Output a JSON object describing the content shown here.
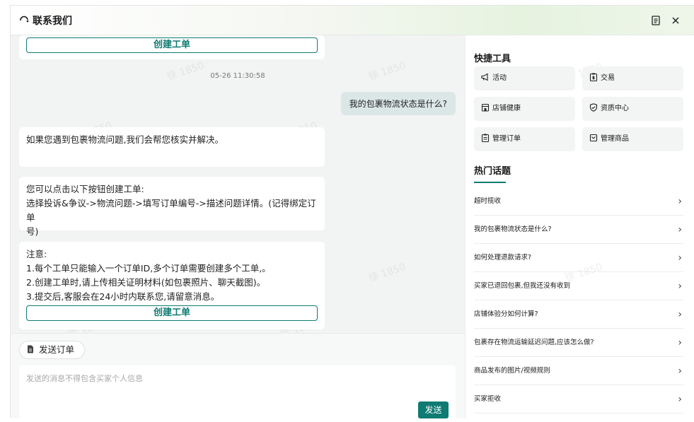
{
  "window": {
    "title": "联系我们"
  },
  "chat": {
    "create_ticket_label": "创建工单",
    "timestamp": "05-26 11:30:58",
    "user_message": "我的包裹物流状态是什么?",
    "bot_reply_1": "如果您遇到包裹物流问题,我们会帮您核实并解决。",
    "bot_reply_2_lines": [
      "您可以点击以下按钮创建工单:",
      "选择投诉&争议->物流问题->填写订单编号->描述问题详情。(记得绑定订单",
      "号)"
    ],
    "bot_reply_3_lines": [
      "注意:",
      "1.每个工单只能输入一个订单ID,多个订单需要创建多个工单,。",
      "2.创建工单时,请上传相关证明材料(如包裹照片、聊天截图)。",
      "3.提交后,客服会在24小时内联系您,请留意消息。"
    ],
    "watermark": "徐 1850"
  },
  "composer": {
    "send_order_label": "发送订单",
    "placeholder": "发送的消息不得包含买家个人信息",
    "send_label": "发送"
  },
  "sidebar": {
    "quick_tools_title": "快捷工具",
    "tools": [
      {
        "label": "活动",
        "icon": "megaphone-icon"
      },
      {
        "label": "交易",
        "icon": "clipboard-dollar-icon"
      },
      {
        "label": "店铺健康",
        "icon": "store-icon"
      },
      {
        "label": "资质中心",
        "icon": "shield-check-icon"
      },
      {
        "label": "管理订单",
        "icon": "clipboard-list-icon"
      },
      {
        "label": "管理商品",
        "icon": "box-icon"
      }
    ],
    "hot_topics_title": "热门话题",
    "topics": [
      "超时揽收",
      "我的包裹物流状态是什么?",
      "如何处理退款请求?",
      "买家已退回包裹,但我还没有收到",
      "店铺体验分如何计算?",
      "包裹存在物流运输延迟问题,应该怎么做?",
      "商品发布的图片/视频规则",
      "买家拒收"
    ]
  },
  "colors": {
    "accent": "#0f7b73",
    "user_bubble": "#dbe7e6"
  }
}
